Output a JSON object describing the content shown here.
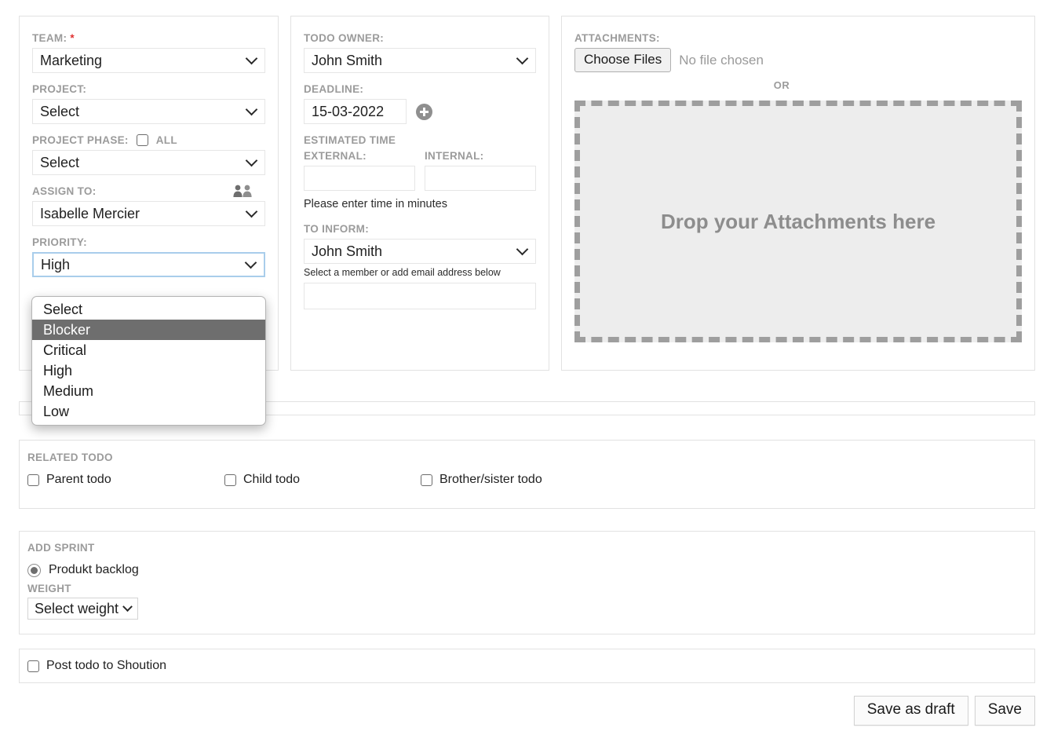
{
  "left_panel": {
    "team": {
      "label": "TEAM:",
      "required_marker": "*",
      "value": "Marketing"
    },
    "project": {
      "label": "PROJECT:",
      "value": "Select"
    },
    "project_phase": {
      "label": "PROJECT PHASE:",
      "all_label": "ALL",
      "value": "Select"
    },
    "assign_to": {
      "label": "ASSIGN TO:",
      "value": "Isabelle Mercier",
      "icon": "people-icon"
    },
    "priority": {
      "label": "PRIORITY:",
      "value": "High",
      "options": [
        "Select",
        "Blocker",
        "Critical",
        "High",
        "Medium",
        "Low"
      ],
      "highlighted_option": "Blocker"
    }
  },
  "middle_panel": {
    "todo_owner": {
      "label": "TODO OWNER:",
      "value": "John Smith"
    },
    "deadline": {
      "label": "DEADLINE:",
      "value": "15-03-2022",
      "add_icon": "plus-circle-icon"
    },
    "estimated_time": {
      "label": "ESTIMATED TIME",
      "external_label": "EXTERNAL:",
      "external_value": "",
      "internal_label": "INTERNAL:",
      "internal_value": "",
      "hint": "Please enter time in minutes"
    },
    "to_inform": {
      "label": "TO INFORM:",
      "value": "John Smith",
      "hint": "Select a member or add email address below",
      "email_value": ""
    }
  },
  "right_panel": {
    "attachments_label": "ATTACHMENTS:",
    "choose_files_button": "Choose Files",
    "no_file_chosen": "No file chosen",
    "or_text": "OR",
    "dropzone_text": "Drop your Attachments here"
  },
  "related_todo": {
    "title": "RELATED TODO",
    "items": [
      {
        "label": "Parent todo",
        "checked": false
      },
      {
        "label": "Child todo",
        "checked": false
      },
      {
        "label": "Brother/sister todo",
        "checked": false
      }
    ]
  },
  "add_sprint": {
    "title": "ADD SPRINT",
    "radio_label": "Produkt backlog",
    "radio_selected": true,
    "weight_label": "WEIGHT",
    "weight_value": "Select weight"
  },
  "post_todo": {
    "label": "Post todo to Shoution",
    "checked": false
  },
  "actions": {
    "save_as_draft": "Save as draft",
    "save": "Save"
  },
  "colors": {
    "label_gray": "#9b9b9b",
    "required_red": "#e03131",
    "focus_blue": "#a9cdeb",
    "highlight_gray": "#6e6e6e",
    "dropzone_border": "#9e9e9e",
    "dropzone_fill": "#ededed"
  }
}
